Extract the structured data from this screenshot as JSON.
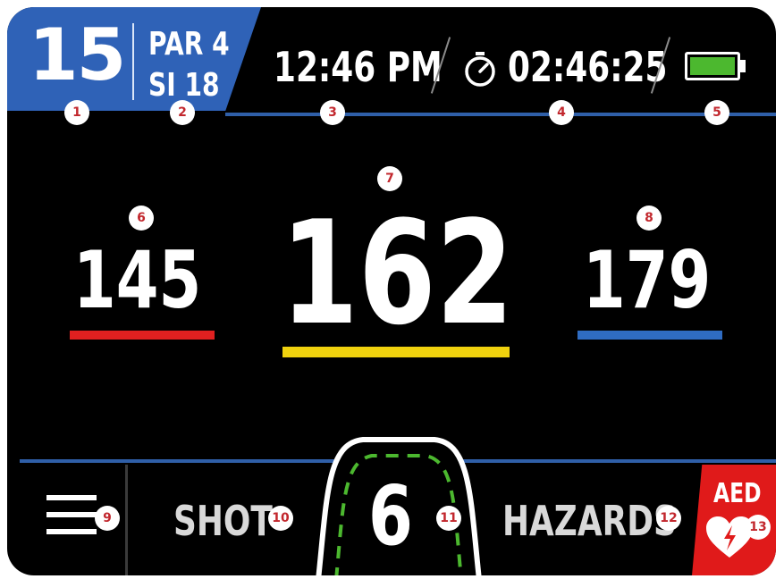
{
  "header": {
    "hole_number": "15",
    "par": "PAR 4",
    "stroke_index": "SI 18",
    "clock": "12:46 PM",
    "round_timer": "02:46:25",
    "battery_level": 1.0,
    "battery_color": "#4cb82f"
  },
  "distances": {
    "front": {
      "value": "145",
      "color": "#e02020"
    },
    "middle": {
      "value": "162",
      "color": "#f0d20e"
    },
    "back": {
      "value": "179",
      "color": "#2f6cc2"
    }
  },
  "bottom": {
    "menu_icon": "hamburger-menu-icon",
    "shot_label": "SHOT",
    "club_number": "6",
    "hazards_label": "HAZARDS",
    "aed_label": "AED",
    "aed_icon": "heart-lightning-icon"
  },
  "callouts": [
    "1",
    "2",
    "3",
    "4",
    "5",
    "6",
    "7",
    "8",
    "9",
    "10",
    "11",
    "12",
    "13"
  ],
  "colors": {
    "accent_blue": "#2f62b7",
    "aed_red": "#e01a1a",
    "callout_red": "#c2272d"
  }
}
